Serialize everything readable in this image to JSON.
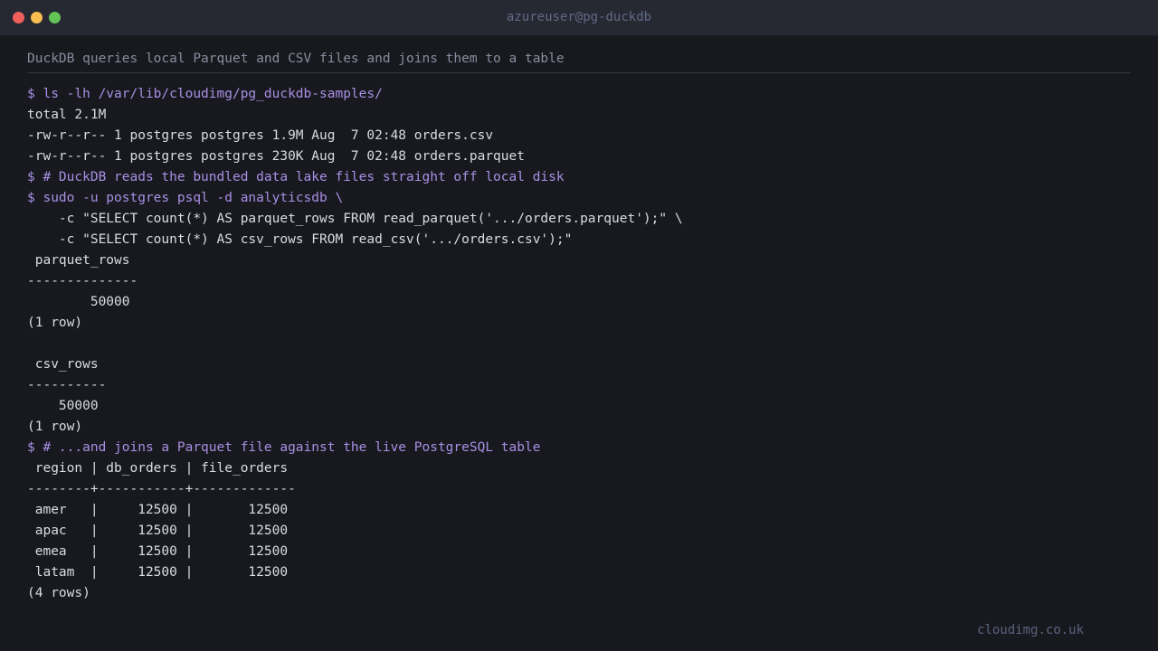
{
  "window": {
    "title": "azureuser@pg-duckdb"
  },
  "caption": "DuckDB queries local Parquet and CSV files and joins them to a table",
  "terminal": {
    "lines": [
      {
        "kind": "cmd",
        "text": "$ ls -lh /var/lib/cloudimg/pg_duckdb-samples/"
      },
      {
        "kind": "out",
        "text": "total 2.1M"
      },
      {
        "kind": "out",
        "text": "-rw-r--r-- 1 postgres postgres 1.9M Aug  7 02:48 orders.csv"
      },
      {
        "kind": "out",
        "text": "-rw-r--r-- 1 postgres postgres 230K Aug  7 02:48 orders.parquet"
      },
      {
        "kind": "cmd",
        "text": "$ # DuckDB reads the bundled data lake files straight off local disk"
      },
      {
        "kind": "cmd",
        "text": "$ sudo -u postgres psql -d analyticsdb \\"
      },
      {
        "kind": "out",
        "text": "    -c \"SELECT count(*) AS parquet_rows FROM read_parquet('.../orders.parquet');\" \\"
      },
      {
        "kind": "out",
        "text": "    -c \"SELECT count(*) AS csv_rows FROM read_csv('.../orders.csv');\""
      },
      {
        "kind": "out",
        "text": " parquet_rows"
      },
      {
        "kind": "out",
        "text": "--------------"
      },
      {
        "kind": "out",
        "text": "        50000"
      },
      {
        "kind": "out",
        "text": "(1 row)"
      },
      {
        "kind": "out",
        "text": ""
      },
      {
        "kind": "out",
        "text": " csv_rows"
      },
      {
        "kind": "out",
        "text": "----------"
      },
      {
        "kind": "out",
        "text": "    50000"
      },
      {
        "kind": "out",
        "text": "(1 row)"
      },
      {
        "kind": "cmd",
        "text": "$ # ...and joins a Parquet file against the live PostgreSQL table"
      },
      {
        "kind": "out",
        "text": " region | db_orders | file_orders"
      },
      {
        "kind": "out",
        "text": "--------+-----------+-------------"
      },
      {
        "kind": "out",
        "text": " amer   |     12500 |       12500"
      },
      {
        "kind": "out",
        "text": " apac   |     12500 |       12500"
      },
      {
        "kind": "out",
        "text": " emea   |     12500 |       12500"
      },
      {
        "kind": "out",
        "text": " latam  |     12500 |       12500"
      },
      {
        "kind": "out",
        "text": "(4 rows)"
      }
    ]
  },
  "footer": "cloudimg.co.uk",
  "colors": {
    "background": "#18191e",
    "titlebar": "#262932",
    "command": "#a88fe5",
    "output": "#dadce3",
    "caption": "#868d9e",
    "close": "#ee5f5b",
    "minimize": "#f6be4f",
    "maximize": "#61c454"
  }
}
